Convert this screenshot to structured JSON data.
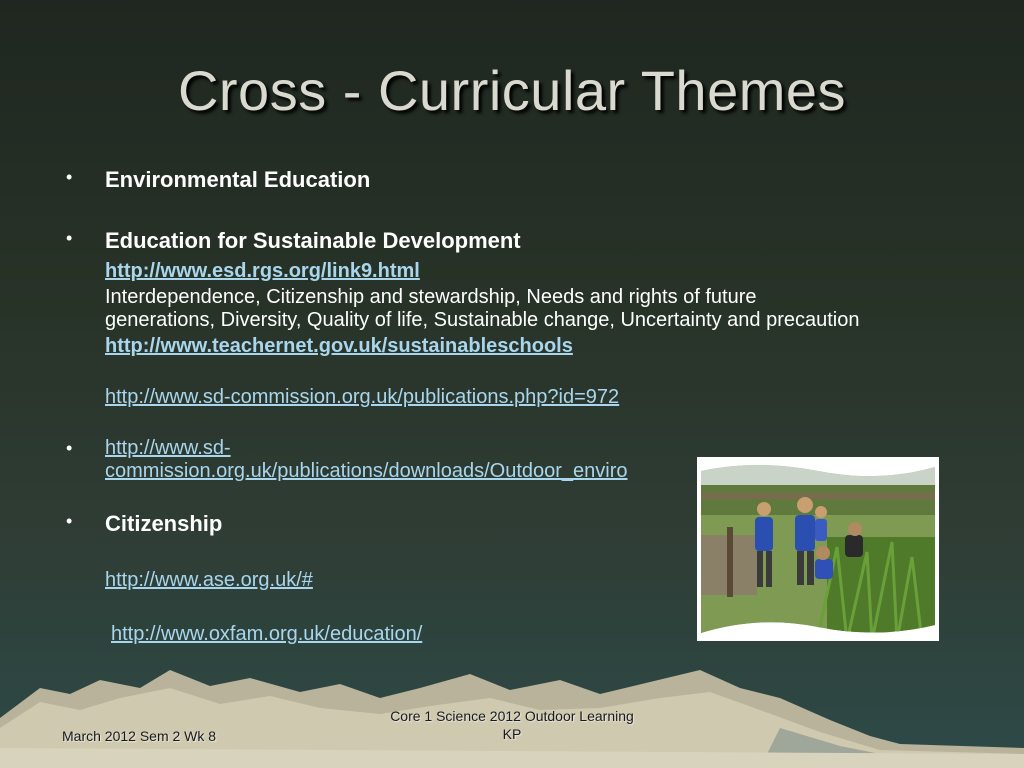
{
  "slide": {
    "title": "Cross - Curricular Themes",
    "bullets": {
      "b1": "Environmental Education",
      "b2": "Education for Sustainable Development",
      "link1": "http://www.esd.rgs.org/link9.html",
      "para1_line1": "Interdependence, Citizenship and stewardship, Needs and rights of future",
      "para1_line2": "generations, Diversity, Quality of life, Sustainable change, Uncertainty and precaution",
      "link2": "http://www.teachernet.gov.uk/sustainableschools",
      "link3": "http://www.sd-commission.org.uk/publications.php?id=972",
      "link4_line1": "http://www.sd-",
      "link4_line2": "commission.org.uk/publications/downloads/Outdoor_enviro",
      "b3": "Citizenship",
      "link5": "http://www.ase.org.uk/#",
      "link6": "http://www.oxfam.org.uk/education/"
    },
    "bullet_glyph": "•"
  },
  "footer": {
    "left": "March 2012  Sem 2 Wk  8",
    "center_line1": "Core 1 Science 2012 Outdoor Learning",
    "center_line2": "KP"
  },
  "colors": {
    "link": "#a9d6ec",
    "title": "#d9d9d0"
  }
}
